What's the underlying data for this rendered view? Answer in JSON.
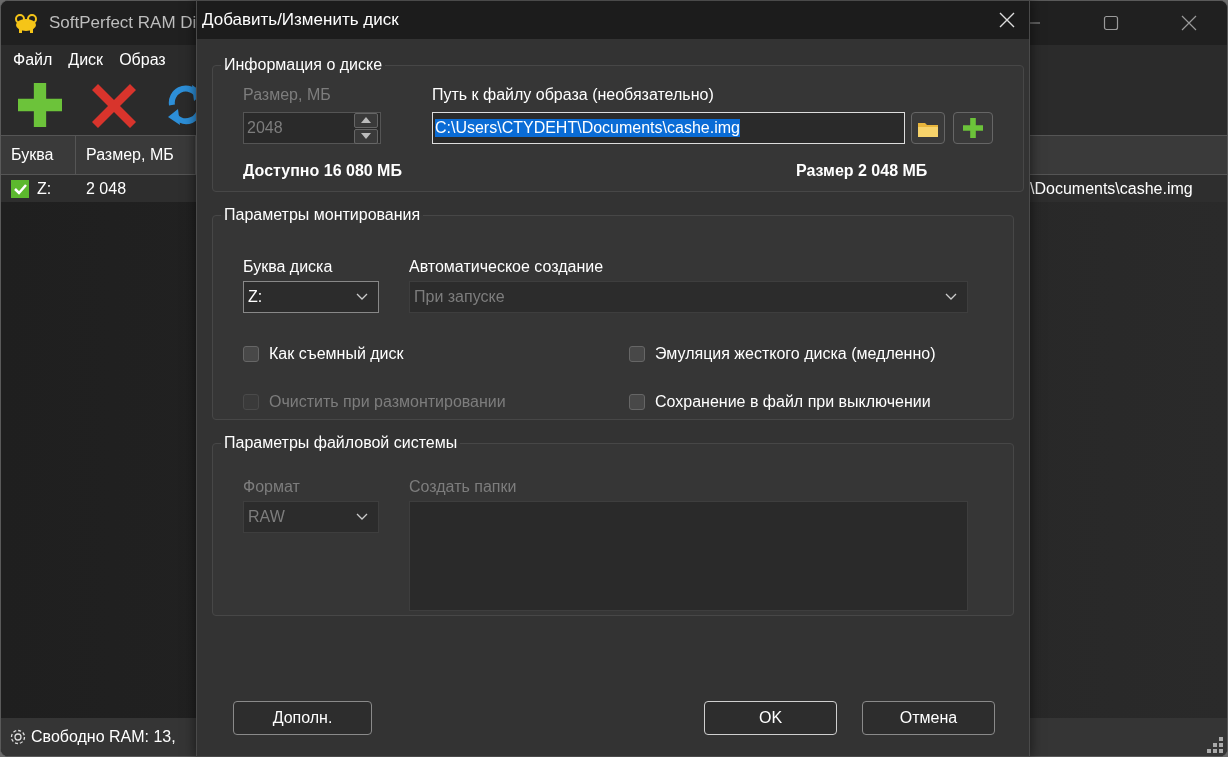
{
  "main_window": {
    "title": "SoftPerfect RAM Di",
    "menu": [
      "Файл",
      "Диск",
      "Образ"
    ],
    "table": {
      "columns": [
        "Буква",
        "Размер, МБ"
      ],
      "rows": [
        {
          "checked": true,
          "letter": "Z:",
          "size": "2 048",
          "path": "\\Documents\\cashe.img"
        }
      ]
    },
    "status_bar": "Свободно RAM: 13,"
  },
  "dialog": {
    "title": "Добавить/Изменить диск",
    "disk_info": {
      "title": "Информация о диске",
      "size_label": "Размер, МБ",
      "size_value": "2048",
      "size_disabled": true,
      "path_label": "Путь к файлу образа (необязательно)",
      "path_value": "C:\\Users\\CTYDEHT\\Documents\\cashe.img",
      "path_selected": true,
      "available": "Доступно 16 080 МБ",
      "size_summary": "Размер 2 048 МБ"
    },
    "mount": {
      "title": "Параметры монтирования",
      "drive_letter_label": "Буква диска",
      "drive_letter": "Z:",
      "auto_label": "Автоматическое создание",
      "auto_value": "При запуске",
      "auto_disabled": true,
      "checkboxes": [
        {
          "label": "Как съемный диск",
          "checked": false,
          "disabled": false
        },
        {
          "label": "Эмуляция жесткого диска (медленно)",
          "checked": false,
          "disabled": false
        },
        {
          "label": "Очистить при размонтировании",
          "checked": false,
          "disabled": true
        },
        {
          "label": "Сохранение в файл при выключении",
          "checked": false,
          "disabled": false
        }
      ]
    },
    "filesystem": {
      "title": "Параметры файловой системы",
      "format_label": "Формат",
      "format": "RAW",
      "format_disabled": true,
      "folders_label": "Создать папки"
    },
    "buttons": [
      {
        "label": "Дополн.",
        "default": false
      },
      {
        "label": "OK",
        "default": true
      },
      {
        "label": "Отмена",
        "default": false
      }
    ]
  }
}
